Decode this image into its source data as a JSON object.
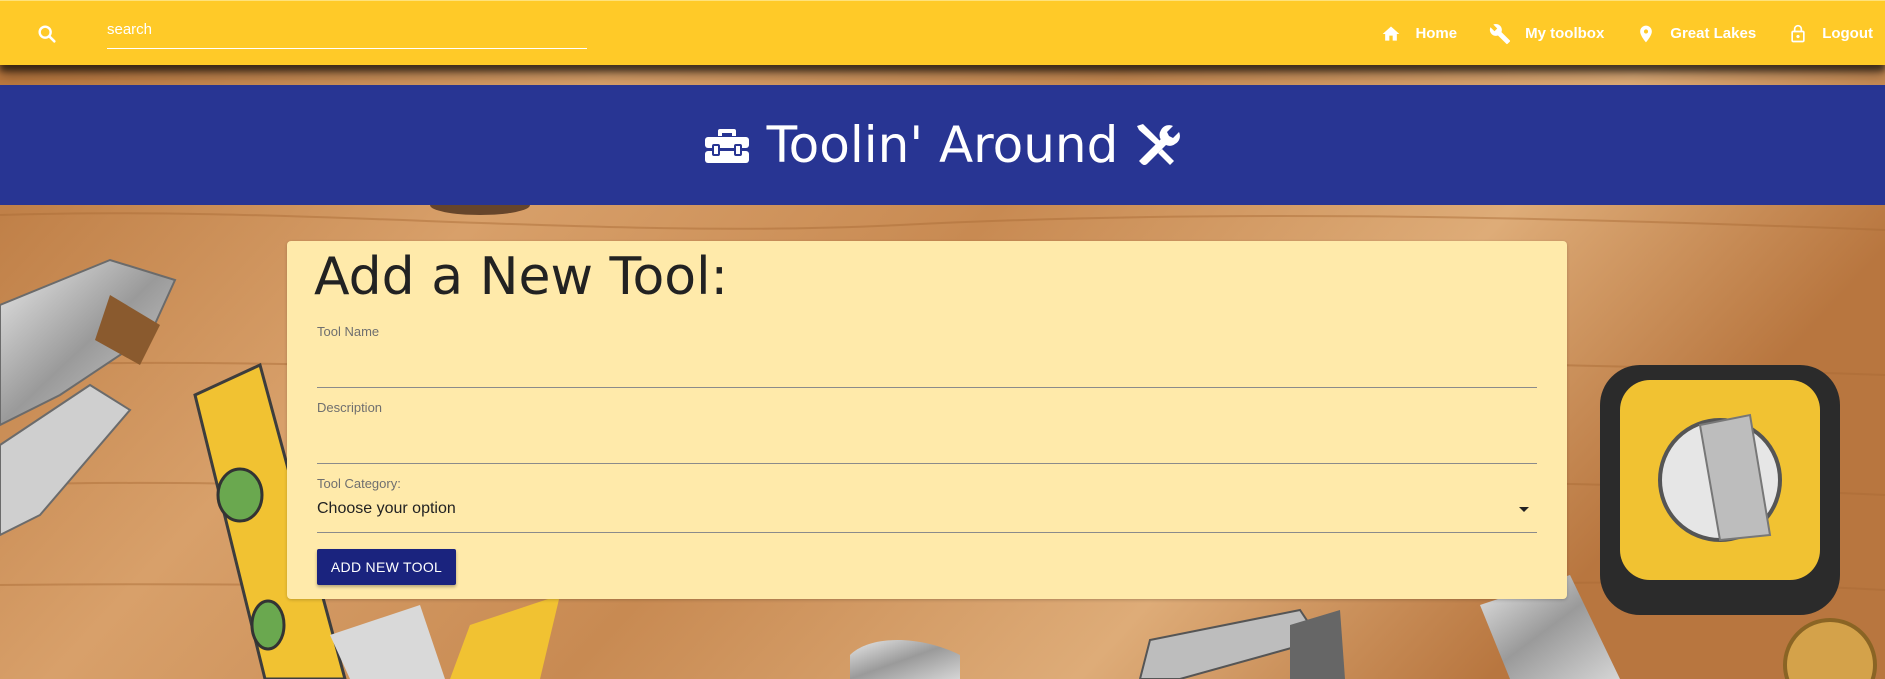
{
  "navbar": {
    "search_placeholder": "search",
    "links": [
      {
        "label": "Home",
        "icon": "home-icon"
      },
      {
        "label": "My toolbox",
        "icon": "wrench-icon"
      },
      {
        "label": "Great Lakes",
        "icon": "location-pin-icon"
      },
      {
        "label": "Logout",
        "icon": "lock-icon"
      }
    ],
    "background_color": "#ffca28"
  },
  "hero": {
    "title": "Toolin' Around",
    "left_icon": "toolbox-icon",
    "right_icon": "tools-icon",
    "background_color": "#283593"
  },
  "form": {
    "title": "Add a New Tool:",
    "tool_name": {
      "label": "Tool Name",
      "value": ""
    },
    "description": {
      "label": "Description",
      "value": ""
    },
    "category": {
      "label": "Tool Category:",
      "selected": "Choose your option"
    },
    "submit_label": "ADD NEW TOOL",
    "card_color": "#ffeaaa",
    "button_color": "#1a237e"
  }
}
